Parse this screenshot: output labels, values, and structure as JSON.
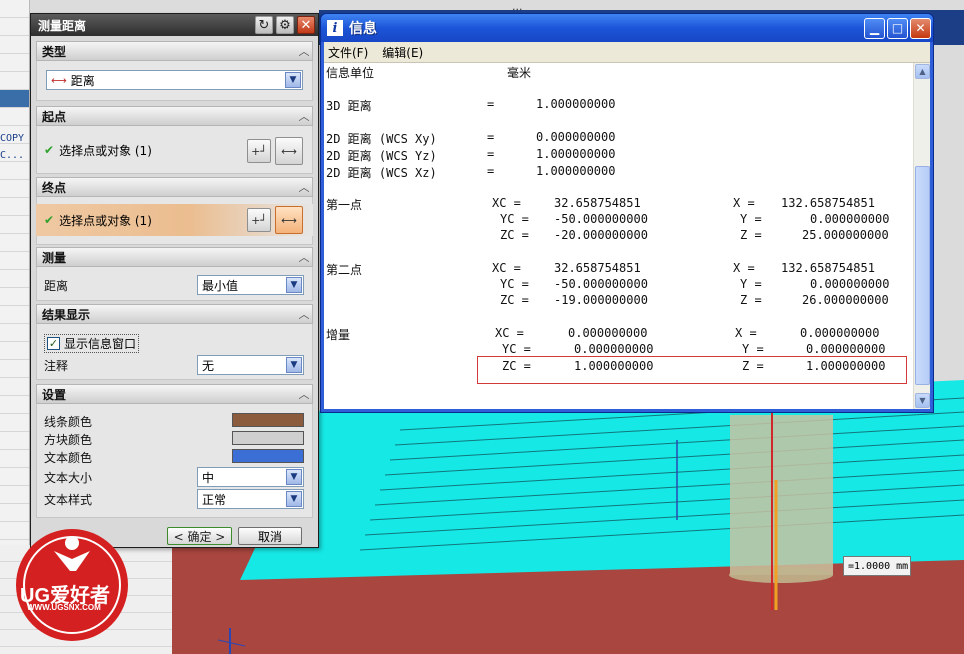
{
  "window_fragment": "...",
  "left_panel": {
    "text_lines": [
      "COPY",
      "C..."
    ]
  },
  "measure_dialog": {
    "title": "测量距离",
    "sections": {
      "type": {
        "title": "类型",
        "value": "距离"
      },
      "start_point": {
        "title": "起点",
        "pick_label": "选择点或对象 (1)"
      },
      "end_point": {
        "title": "终点",
        "pick_label": "选择点或对象 (1)"
      },
      "measure": {
        "title": "测量",
        "label": "距离",
        "value": "最小值"
      },
      "result_display": {
        "title": "结果显示",
        "checkbox_label": "显示信息窗口",
        "checked": true,
        "annotation_label": "注释",
        "annotation_value": "无"
      },
      "settings": {
        "title": "设置",
        "line_color_label": "线条颜色",
        "line_color": "#8c5a3c",
        "block_color_label": "方块颜色",
        "block_color": "#cfcfcf",
        "text_color_label": "文本颜色",
        "text_color": "#3b6fd6",
        "text_size_label": "文本大小",
        "text_size_value": "中",
        "text_style_label": "文本样式",
        "text_style_value": "正常"
      }
    },
    "ok_label": "< 确定 >",
    "cancel_label": "取消"
  },
  "info_window": {
    "title": "信息",
    "menu": [
      "文件(F)",
      "编辑(E)"
    ],
    "lines": [
      {
        "label": "信息单位",
        "value": "毫米"
      },
      {
        "label": "3D 距离",
        "eq": "=",
        "value": "1.000000000"
      },
      {
        "label": "2D 距离 (WCS Xy)",
        "eq": "=",
        "value": "0.000000000"
      },
      {
        "label": "2D 距离 (WCS Yz)",
        "eq": "=",
        "value": "1.000000000"
      },
      {
        "label": "2D 距离 (WCS Xz)",
        "eq": "=",
        "value": "1.000000000"
      }
    ],
    "points": [
      {
        "title": "第一点",
        "rows": [
          {
            "wk": "XC =",
            "wv": "32.658754851",
            "ak": "X =",
            "av": "132.658754851"
          },
          {
            "wk": "YC =",
            "wv": "-50.000000000",
            "ak": "Y =",
            "av": "0.000000000"
          },
          {
            "wk": "ZC =",
            "wv": "-20.000000000",
            "ak": "Z =",
            "av": "25.000000000"
          }
        ]
      },
      {
        "title": "第二点",
        "rows": [
          {
            "wk": "XC =",
            "wv": "32.658754851",
            "ak": "X =",
            "av": "132.658754851"
          },
          {
            "wk": "YC =",
            "wv": "-50.000000000",
            "ak": "Y =",
            "av": "0.000000000"
          },
          {
            "wk": "ZC =",
            "wv": "-19.000000000",
            "ak": "Z =",
            "av": "26.000000000"
          }
        ]
      },
      {
        "title": "增量",
        "rows": [
          {
            "wk": "XC =",
            "wv": "0.000000000",
            "ak": "X =",
            "av": "0.000000000"
          },
          {
            "wk": "YC =",
            "wv": "0.000000000",
            "ak": "Y =",
            "av": "0.000000000"
          },
          {
            "wk": "ZC =",
            "wv": "1.000000000",
            "ak": "Z =",
            "av": "1.000000000"
          }
        ]
      }
    ]
  },
  "dimension_tag": "=1.0000 mm",
  "watermark": {
    "main": "UG爱好者",
    "url": "WWW.UGSNX.COM"
  },
  "colors": {
    "cyan_model": "#17f0ee",
    "floor": "#a9463f",
    "dialog_bg": "#d9d9d9"
  }
}
